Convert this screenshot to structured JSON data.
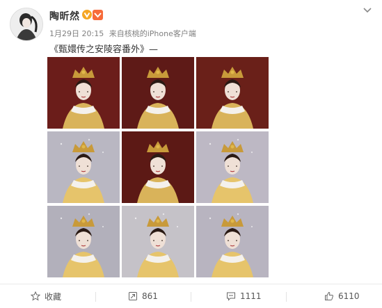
{
  "post": {
    "username": "陶昕然",
    "date": "1月29日 20:15",
    "source_prefix": "来自",
    "source": "核桃的iPhone客户端",
    "text": "《甄嬛传之安陵容番外》—"
  },
  "photos": [
    {
      "label": "photo-1",
      "bg": "#6b1d1a"
    },
    {
      "label": "photo-2",
      "bg": "#5e1a17"
    },
    {
      "label": "photo-3",
      "bg": "#6a2019"
    },
    {
      "label": "photo-4",
      "bg": "#b9b7c2"
    },
    {
      "label": "photo-5",
      "bg": "#5c1915"
    },
    {
      "label": "photo-6",
      "bg": "#bdb8c4"
    },
    {
      "label": "photo-7",
      "bg": "#b2b0bb"
    },
    {
      "label": "photo-8",
      "bg": "#c5c2c8"
    },
    {
      "label": "photo-9",
      "bg": "#b8b4c0"
    }
  ],
  "actions": {
    "favorite": "收藏",
    "repost": "861",
    "comment": "1111",
    "like": "6110"
  },
  "colors": {
    "accent": "#f76b3a",
    "verified": "#f5a623",
    "muted": "#808080"
  }
}
